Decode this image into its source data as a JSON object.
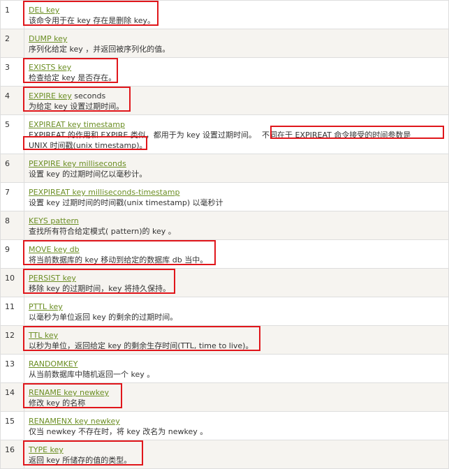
{
  "rows": [
    {
      "num": "1",
      "cmd": "DEL key",
      "args": "",
      "desc": "该命令用于在 key 存在是删除 key。"
    },
    {
      "num": "2",
      "cmd": "DUMP key",
      "args": "",
      "desc": "序列化给定 key ，并返回被序列化的值。"
    },
    {
      "num": "3",
      "cmd": "EXISTS key",
      "args": "",
      "desc": "检查给定 key 是否存在。"
    },
    {
      "num": "4",
      "cmd": "EXPIRE key",
      "args": " seconds",
      "desc": "为给定 key 设置过期时间。"
    },
    {
      "num": "5",
      "cmd": "EXPIREAT key timestamp",
      "args": "",
      "desc": "EXPIREAT 的作用和 EXPIRE 类似，都用于为 key 设置过期时间。",
      "desc2": "不同在于 EXPIREAT 命令接受的时间参数是",
      "desc3": "UNIX 时间戳(unix timestamp)。"
    },
    {
      "num": "6",
      "cmd": "PEXPIRE key milliseconds",
      "args": "",
      "desc": "设置 key 的过期时间亿以毫秒计。"
    },
    {
      "num": "7",
      "cmd": "PEXPIREAT key milliseconds-timestamp",
      "args": "",
      "desc": "设置 key 过期时间的时间戳(unix timestamp) 以毫秒计"
    },
    {
      "num": "8",
      "cmd": "KEYS pattern",
      "args": "",
      "desc": "查找所有符合给定模式( pattern)的 key 。"
    },
    {
      "num": "9",
      "cmd": "MOVE key db",
      "args": "",
      "desc": "将当前数据库的 key 移动到给定的数据库 db 当中。"
    },
    {
      "num": "10",
      "cmd": "PERSIST key",
      "args": "",
      "desc": "移除 key 的过期时间，key 将持久保持。"
    },
    {
      "num": "11",
      "cmd": "PTTL key",
      "args": "",
      "desc": "以毫秒为单位返回 key 的剩余的过期时间。"
    },
    {
      "num": "12",
      "cmd": "TTL key",
      "args": "",
      "desc": "以秒为单位，返回给定 key 的剩余生存时间(TTL, time to live)。"
    },
    {
      "num": "13",
      "cmd": "RANDOMKEY",
      "args": "",
      "desc": "从当前数据库中随机返回一个 key 。"
    },
    {
      "num": "14",
      "cmd": "RENAME key newkey",
      "args": "",
      "desc": "修改 key 的名称"
    },
    {
      "num": "15",
      "cmd": "RENAMENX key newkey",
      "args": "",
      "desc": "仅当 newkey 不存在时，将 key 改名为 newkey 。"
    },
    {
      "num": "16",
      "cmd": "TYPE key",
      "args": "",
      "desc": "返回 key 所储存的值的类型。"
    }
  ],
  "colors": {
    "link": "#6b8e23",
    "highlight": "#e0161b",
    "row_alt": "#f6f4f0",
    "border": "#dddddd"
  }
}
